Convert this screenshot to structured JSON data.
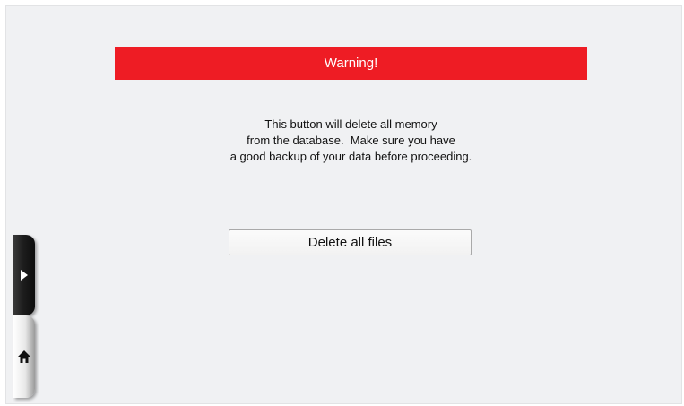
{
  "warning": {
    "title": "Warning!"
  },
  "message": {
    "lines": [
      "This button will delete all memory",
      "from the database.  Make sure you have",
      "a good backup of your data before proceeding."
    ]
  },
  "actions": {
    "delete_label": "Delete all files"
  },
  "side_nav": {
    "forward_icon": "play-arrow-icon",
    "home_icon": "home-icon"
  },
  "colors": {
    "warning_red": "#ee1c24",
    "background": "#f0f1f3"
  }
}
